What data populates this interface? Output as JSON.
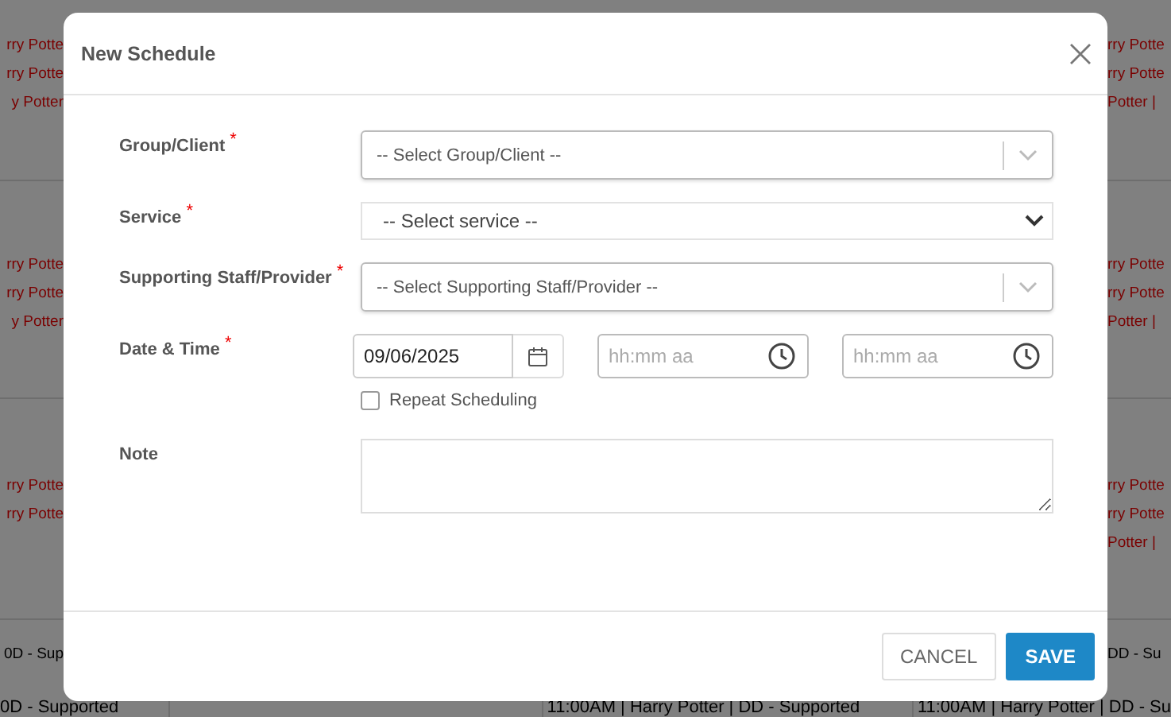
{
  "background": {
    "sections": [
      {
        "left": [
          {
            "text": "rry Potte",
            "color": "#7a0000"
          },
          {
            "text": "rry Potte",
            "color": "#7a0000"
          },
          {
            "text": "y Potter",
            "color": "#7a0000"
          }
        ],
        "right": [
          {
            "text": "rry Potte",
            "color": "#7a0000"
          },
          {
            "text": "rry Potte",
            "color": "#7a0000"
          },
          {
            "text": "Potter |",
            "color": "#7a0000"
          }
        ]
      },
      {
        "left": [
          {
            "text": "rry Potte",
            "color": "#7a0000"
          },
          {
            "text": "rry Potte",
            "color": "#7a0000"
          },
          {
            "text": "y Potter",
            "color": "#7a0000"
          }
        ],
        "right": [
          {
            "text": "rry Potte",
            "color": "#7a0000"
          },
          {
            "text": "rry Potte",
            "color": "#7a0000"
          },
          {
            "text": "Potter |",
            "color": "#7a0000"
          }
        ]
      },
      {
        "left": [
          {
            "text": "rry Potte",
            "color": "#7a0000"
          },
          {
            "text": "rry Potte",
            "color": "#7a0000"
          }
        ],
        "right": [
          {
            "text": "rry Potte",
            "color": "#7a0000"
          },
          {
            "text": "rry Potte",
            "color": "#7a0000"
          },
          {
            "text": "Potter |",
            "color": "#7a0000"
          }
        ]
      }
    ],
    "bottom": {
      "left": [
        {
          "text": "0D - Sup",
          "color": "#000000"
        }
      ],
      "right": [
        {
          "text": "DD - Su",
          "color": "#000000"
        }
      ]
    },
    "last_row": [
      {
        "text": "0D - Supported",
        "color": "#000000"
      },
      {
        "text": "11:00AM | Harry Potter | DD - Supported",
        "color": "#000000"
      },
      {
        "text": "11:00AM | Harry Potter | DD - Su",
        "color": "#000000"
      }
    ]
  },
  "modal": {
    "title": "New Schedule",
    "fields": [
      {
        "kind": "combo",
        "label": "Group/Client",
        "required_mark": "*",
        "placeholder": "-- Select Group/Client --"
      },
      {
        "kind": "select",
        "label": "Service",
        "required_mark": "*",
        "placeholder": "-- Select service --"
      },
      {
        "kind": "combo",
        "label": "Supporting Staff/Provider",
        "required_mark": "*",
        "placeholder": "-- Select Supporting Staff/Provider --"
      },
      {
        "kind": "datetime",
        "label": "Date & Time",
        "required_mark": "*",
        "date": "09/06/2025",
        "start_placeholder": "hh:mm aa",
        "end_placeholder": "hh:mm aa"
      }
    ],
    "repeat": {
      "label": "Repeat Scheduling",
      "checked": false
    },
    "note": {
      "label": "Note"
    },
    "buttons": [
      {
        "kind": "secondary",
        "label": "CANCEL"
      },
      {
        "kind": "primary",
        "label": "SAVE"
      }
    ]
  }
}
